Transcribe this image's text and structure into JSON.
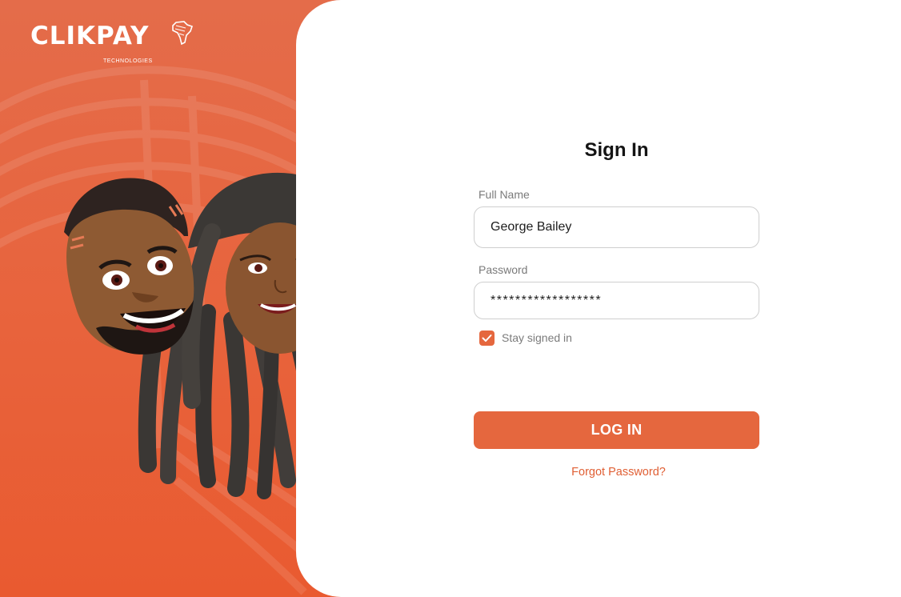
{
  "brand": {
    "name": "CLIKPAY",
    "tagline": "TECHNOLOGIES",
    "primary_color": "#e5673e",
    "logo_icon": "africa-map-icon"
  },
  "hero": {
    "illustration_icon": "couple-avatar-illustration"
  },
  "form": {
    "title": "Sign In",
    "full_name_label": "Full Name",
    "full_name_value": "George Bailey",
    "password_label": "Password",
    "password_value": "******************",
    "stay_signed_in_label": "Stay signed in",
    "stay_signed_in_checked": true,
    "login_button_label": "LOG IN",
    "forgot_password_label": "Forgot Password?"
  }
}
